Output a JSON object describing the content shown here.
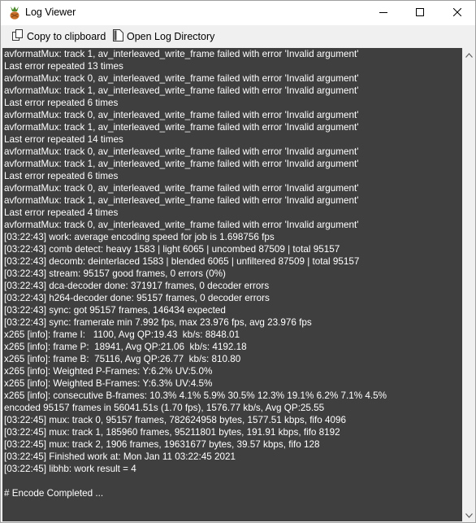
{
  "window": {
    "title": "Log Viewer",
    "app_icon": "handbrake-pineapple-icon"
  },
  "controls": {
    "minimize_icon": "minimize-icon",
    "maximize_icon": "maximize-icon",
    "close_icon": "close-icon"
  },
  "toolbar": {
    "copy_label": "Copy to clipboard",
    "copy_icon": "copy-icon",
    "open_label": "Open Log Directory",
    "open_icon": "document-icon"
  },
  "log": {
    "lines": [
      "avformatMux: track 1, av_interleaved_write_frame failed with error 'Invalid argument'",
      "Last error repeated 13 times",
      "avformatMux: track 0, av_interleaved_write_frame failed with error 'Invalid argument'",
      "avformatMux: track 1, av_interleaved_write_frame failed with error 'Invalid argument'",
      "Last error repeated 6 times",
      "avformatMux: track 0, av_interleaved_write_frame failed with error 'Invalid argument'",
      "avformatMux: track 1, av_interleaved_write_frame failed with error 'Invalid argument'",
      "Last error repeated 14 times",
      "avformatMux: track 0, av_interleaved_write_frame failed with error 'Invalid argument'",
      "avformatMux: track 1, av_interleaved_write_frame failed with error 'Invalid argument'",
      "Last error repeated 6 times",
      "avformatMux: track 0, av_interleaved_write_frame failed with error 'Invalid argument'",
      "avformatMux: track 1, av_interleaved_write_frame failed with error 'Invalid argument'",
      "Last error repeated 4 times",
      "avformatMux: track 0, av_interleaved_write_frame failed with error 'Invalid argument'",
      "[03:22:43] work: average encoding speed for job is 1.698756 fps",
      "[03:22:43] comb detect: heavy 1583 | light 6065 | uncombed 87509 | total 95157",
      "[03:22:43] decomb: deinterlaced 1583 | blended 6065 | unfiltered 87509 | total 95157",
      "[03:22:43] stream: 95157 good frames, 0 errors (0%)",
      "[03:22:43] dca-decoder done: 371917 frames, 0 decoder errors",
      "[03:22:43] h264-decoder done: 95157 frames, 0 decoder errors",
      "[03:22:43] sync: got 95157 frames, 146434 expected",
      "[03:22:43] sync: framerate min 7.992 fps, max 23.976 fps, avg 23.976 fps",
      "x265 [info]: frame I:   1100, Avg QP:19.43  kb/s: 8848.01",
      "x265 [info]: frame P:  18941, Avg QP:21.06  kb/s: 4192.18",
      "x265 [info]: frame B:  75116, Avg QP:26.77  kb/s: 810.80",
      "x265 [info]: Weighted P-Frames: Y:6.2% UV:5.0%",
      "x265 [info]: Weighted B-Frames: Y:6.3% UV:4.5%",
      "x265 [info]: consecutive B-frames: 10.3% 4.1% 5.9% 30.5% 12.3% 19.1% 6.2% 7.1% 4.5%",
      "encoded 95157 frames in 56041.51s (1.70 fps), 1576.77 kb/s, Avg QP:25.55",
      "[03:22:45] mux: track 0, 95157 frames, 782624958 bytes, 1577.51 kbps, fifo 4096",
      "[03:22:45] mux: track 1, 185960 frames, 95211801 bytes, 191.91 kbps, fifo 8192",
      "[03:22:45] mux: track 2, 1906 frames, 19631677 bytes, 39.57 kbps, fifo 128",
      "[03:22:45] Finished work at: Mon Jan 11 03:22:45 2021",
      "[03:22:45] libhb: work result = 4",
      "",
      "# Encode Completed ..."
    ]
  },
  "scrollbar": {
    "up_icon": "scroll-up-arrow-icon",
    "down_icon": "scroll-down-arrow-icon"
  }
}
